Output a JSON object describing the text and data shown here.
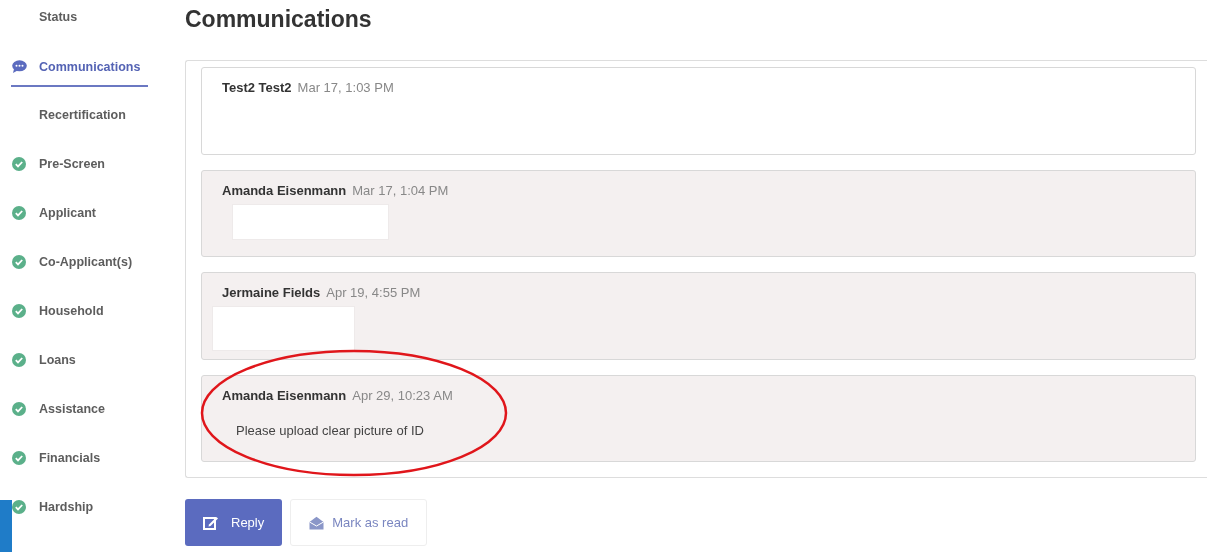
{
  "sidebar": {
    "items": [
      {
        "label": "Status",
        "kind": "plain",
        "selected": false
      },
      {
        "label": "Communications",
        "kind": "chat",
        "selected": true
      },
      {
        "label": "Recertification",
        "kind": "plain",
        "selected": false
      },
      {
        "label": "Pre-Screen",
        "kind": "done",
        "selected": false
      },
      {
        "label": "Applicant",
        "kind": "done",
        "selected": false
      },
      {
        "label": "Co-Applicant(s)",
        "kind": "done",
        "selected": false
      },
      {
        "label": "Household",
        "kind": "done",
        "selected": false
      },
      {
        "label": "Loans",
        "kind": "done",
        "selected": false
      },
      {
        "label": "Assistance",
        "kind": "done",
        "selected": false
      },
      {
        "label": "Financials",
        "kind": "done",
        "selected": false
      },
      {
        "label": "Hardship",
        "kind": "done",
        "selected": false
      }
    ]
  },
  "page": {
    "title": "Communications"
  },
  "messages": [
    {
      "author": "Test2 Test2",
      "time": "Mar 17, 1:03 PM",
      "read": true,
      "redacted": false,
      "circled": false
    },
    {
      "author": "Amanda Eisenmann",
      "time": "Mar 17, 1:04 PM",
      "read": false,
      "redacted": true,
      "circled": false
    },
    {
      "author": "Jermaine Fields",
      "time": "Apr 19, 4:55 PM",
      "read": false,
      "redacted": true,
      "circled": false
    },
    {
      "author": "Amanda Eisenmann",
      "time": "Apr 29, 10:23 AM",
      "read": false,
      "redacted": false,
      "circled": true,
      "body": "Please upload clear picture of ID"
    }
  ],
  "buttons": {
    "reply": "Reply",
    "mark_read": "Mark as read"
  }
}
